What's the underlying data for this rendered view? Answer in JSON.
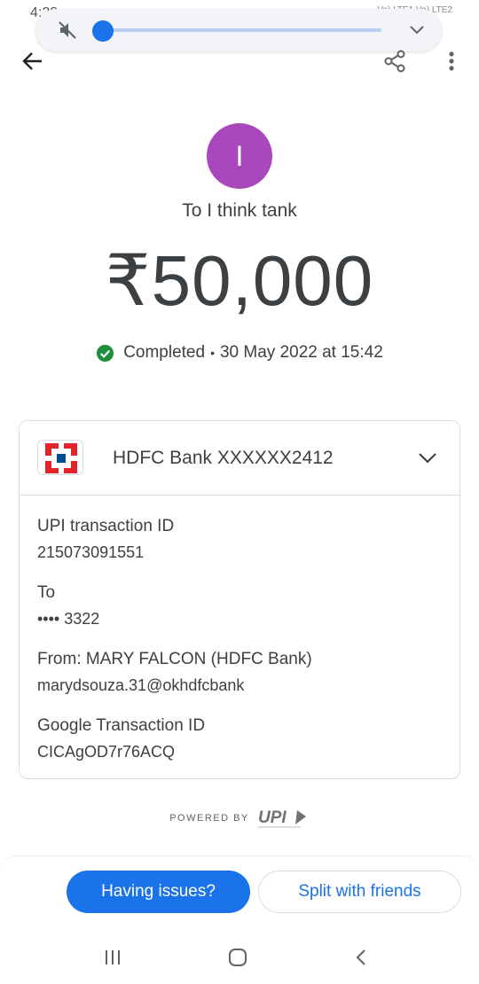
{
  "status_bar": {
    "time": "4:28",
    "right_text": "Vo) LTE1 Vo) LTE2"
  },
  "volume": {
    "level": 0.0
  },
  "header": {
    "avatar_letter": "I",
    "payee": "To I think tank",
    "amount": "₹50,000",
    "status": "Completed",
    "separator": "•",
    "datetime": "30 May 2022 at 15:42"
  },
  "card": {
    "bank": "HDFC Bank XXXXXX2412",
    "details": [
      {
        "label": "UPI transaction ID",
        "value": "215073091551"
      },
      {
        "label": "To",
        "value": "•••• 3322"
      },
      {
        "label": "From: MARY FALCON (HDFC Bank)",
        "value": "marydsouza.31@okhdfcbank"
      },
      {
        "label": "Google Transaction ID",
        "value": "CICAgOD7r76ACQ"
      }
    ]
  },
  "footer": {
    "powered_by": "POWERED BY",
    "upi_logo": "UPI"
  },
  "actions": {
    "issues_label": "Having issues?",
    "split_label": "Split with friends"
  },
  "colors": {
    "primary": "#1a73e8",
    "avatar": "#ab47bc",
    "success": "#1e8e3e",
    "hdfc_red": "#e4232b",
    "hdfc_blue": "#004c8f"
  },
  "icons": {
    "mute": "mute-icon",
    "back": "arrow-left-icon",
    "share": "share-icon",
    "more": "more-vert-icon",
    "check": "check-circle-icon",
    "chevron": "chevron-down-icon"
  }
}
